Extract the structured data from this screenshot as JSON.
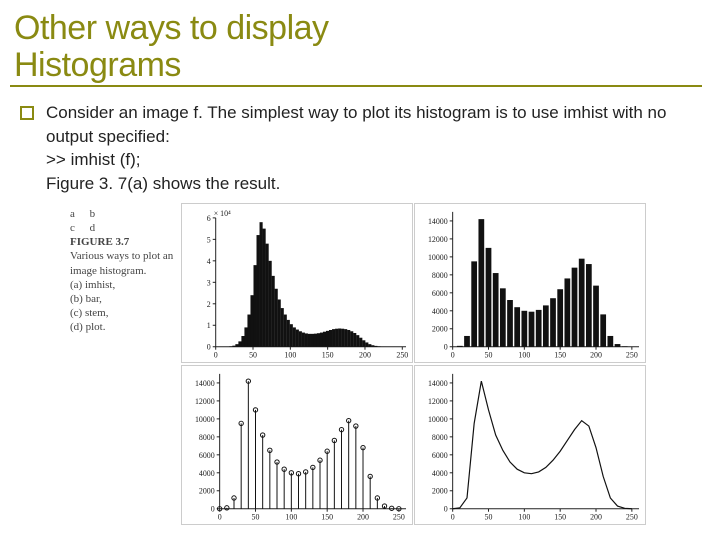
{
  "title_line1": "Other ways to display",
  "title_line2": "Histograms",
  "bullet_text": "Consider an image f. The simplest way to plot its histogram is to use imhist with no output specified:",
  "code_line": ">> imhist (f);",
  "result_line": "Figure 3. 7(a) shows the result.",
  "caption": {
    "letters": "a b\nc d",
    "fig": "FIGURE 3.7",
    "desc": "Various ways to plot an image histogram.",
    "items": [
      "(a) imhist,",
      "(b) bar,",
      "(c) stem,",
      "(d) plot."
    ]
  },
  "chart_data": [
    {
      "type": "bar",
      "title": "",
      "xlabel": "",
      "ylabel": "",
      "y_unit": "× 10⁴",
      "x": [
        0,
        50,
        100,
        150,
        200,
        250
      ],
      "xlim": [
        0,
        255
      ],
      "ylim": [
        0,
        60000
      ],
      "yticks_label": [
        "0",
        "1",
        "2",
        "3",
        "4",
        "5",
        "6"
      ],
      "categories_note": "256 intensity bins 0–255",
      "values": [
        0,
        0,
        0,
        0,
        0,
        200,
        500,
        1200,
        2500,
        5000,
        9000,
        15000,
        24000,
        38000,
        52000,
        58000,
        55000,
        48000,
        40000,
        33000,
        27000,
        22000,
        18000,
        15000,
        12500,
        10500,
        9000,
        8000,
        7200,
        6600,
        6200,
        6000,
        6000,
        6100,
        6300,
        6600,
        7000,
        7400,
        7800,
        8200,
        8400,
        8500,
        8400,
        8200,
        7800,
        7200,
        6400,
        5400,
        4200,
        3000,
        2000,
        1200,
        700,
        400,
        200,
        100,
        50,
        20,
        10,
        5,
        0,
        0,
        0,
        0
      ]
    },
    {
      "type": "bar",
      "title": "",
      "xlabel": "",
      "ylabel": "",
      "xlim": [
        0,
        260
      ],
      "ylim": [
        0,
        15000
      ],
      "xticks": [
        0,
        50,
        100,
        150,
        200,
        250
      ],
      "yticks": [
        0,
        2000,
        4000,
        6000,
        8000,
        10000,
        12000,
        14000
      ],
      "categories": [
        0,
        10,
        20,
        30,
        40,
        50,
        60,
        70,
        80,
        90,
        100,
        110,
        120,
        130,
        140,
        150,
        160,
        170,
        180,
        190,
        200,
        210,
        220,
        230,
        240,
        250
      ],
      "values": [
        0,
        100,
        1200,
        9500,
        14200,
        11000,
        8200,
        6500,
        5200,
        4400,
        4000,
        3900,
        4100,
        4600,
        5400,
        6400,
        7600,
        8800,
        9800,
        9200,
        6800,
        3600,
        1200,
        300,
        50,
        0
      ]
    },
    {
      "type": "scatter",
      "render": "stem",
      "title": "",
      "xlabel": "",
      "ylabel": "",
      "xlim": [
        0,
        260
      ],
      "ylim": [
        0,
        15000
      ],
      "xticks": [
        0,
        50,
        100,
        150,
        200,
        250
      ],
      "yticks": [
        0,
        2000,
        4000,
        6000,
        8000,
        10000,
        12000,
        14000
      ],
      "x": [
        0,
        10,
        20,
        30,
        40,
        50,
        60,
        70,
        80,
        90,
        100,
        110,
        120,
        130,
        140,
        150,
        160,
        170,
        180,
        190,
        200,
        210,
        220,
        230,
        240,
        250
      ],
      "values": [
        0,
        100,
        1200,
        9500,
        14200,
        11000,
        8200,
        6500,
        5200,
        4400,
        4000,
        3900,
        4100,
        4600,
        5400,
        6400,
        7600,
        8800,
        9800,
        9200,
        6800,
        3600,
        1200,
        300,
        50,
        0
      ]
    },
    {
      "type": "line",
      "title": "",
      "xlabel": "",
      "ylabel": "",
      "xlim": [
        0,
        260
      ],
      "ylim": [
        0,
        15000
      ],
      "xticks": [
        0,
        50,
        100,
        150,
        200,
        250
      ],
      "yticks": [
        0,
        2000,
        4000,
        6000,
        8000,
        10000,
        12000,
        14000
      ],
      "x": [
        0,
        10,
        20,
        30,
        40,
        50,
        60,
        70,
        80,
        90,
        100,
        110,
        120,
        130,
        140,
        150,
        160,
        170,
        180,
        190,
        200,
        210,
        220,
        230,
        240,
        250
      ],
      "values": [
        0,
        100,
        1200,
        9500,
        14200,
        11000,
        8200,
        6500,
        5200,
        4400,
        4000,
        3900,
        4100,
        4600,
        5400,
        6400,
        7600,
        8800,
        9800,
        9200,
        6800,
        3600,
        1200,
        300,
        50,
        0
      ]
    }
  ]
}
